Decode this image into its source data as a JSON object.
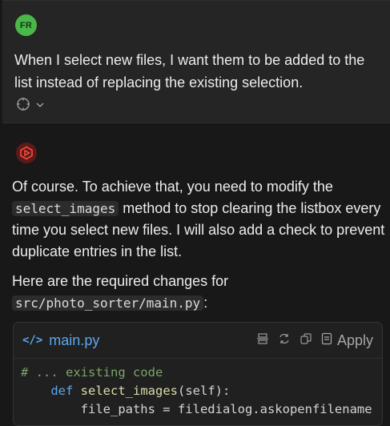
{
  "user": {
    "avatar_initials": "FR",
    "message": "When I select new files, I want them to be added to the list instead of replacing the existing selection."
  },
  "assistant": {
    "p1_before": "Of course. To achieve that, you need to modify the ",
    "p1_code": "select_images",
    "p1_after": " method to stop clearing the listbox every time you select new files. I will also add a check to prevent duplicate entries in the list.",
    "p2_before": "Here are the required changes for ",
    "p2_code": "src/photo_sorter/main.py",
    "p2_after": ":"
  },
  "code_block": {
    "tag": "</>",
    "filename": "main.py",
    "apply_label": "Apply",
    "line1": "# ... existing code",
    "line2_indent": "    ",
    "line2_kw": "def",
    "line2_fn": "select_images",
    "line2_rest": "(self):",
    "line3": "        file_paths = filedialog.askopenfilename"
  }
}
